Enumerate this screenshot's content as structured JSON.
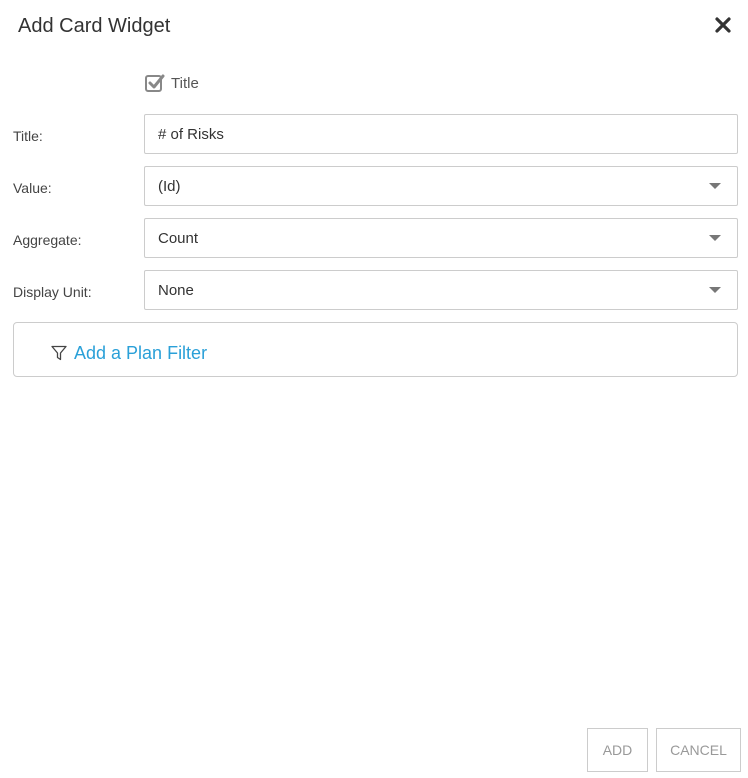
{
  "dialog": {
    "title": "Add Card Widget",
    "close_icon": "close-icon"
  },
  "title_toggle": {
    "label": "Title",
    "checked": true,
    "icon": "checkbox-checked-icon"
  },
  "form": {
    "title": {
      "label": "Title:",
      "value": "# of Risks"
    },
    "value": {
      "label": "Value:",
      "selected": "(Id)"
    },
    "aggregate": {
      "label": "Aggregate:",
      "selected": "Count"
    },
    "display_unit": {
      "label": "Display Unit:",
      "selected": "None"
    }
  },
  "filter": {
    "link_label": "Add a Plan Filter",
    "icon": "funnel-icon",
    "color": "#2aa0d8"
  },
  "footer": {
    "add_label": "ADD",
    "cancel_label": "CANCEL"
  }
}
